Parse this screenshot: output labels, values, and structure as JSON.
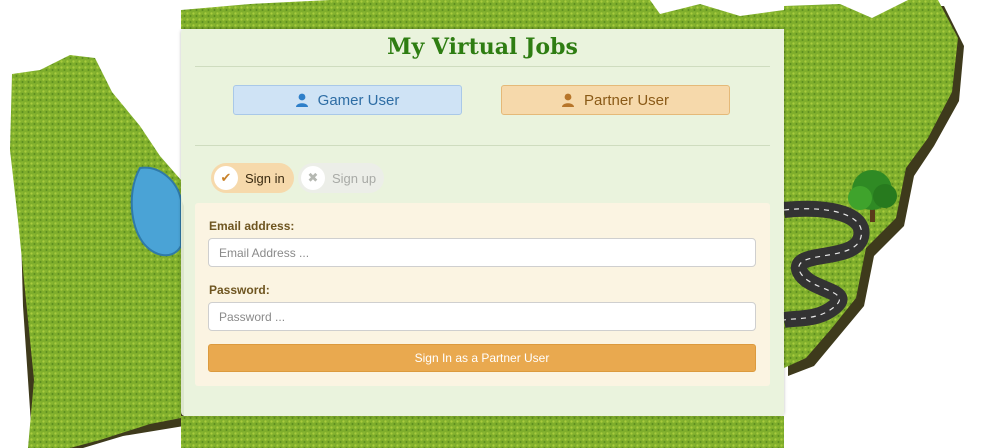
{
  "app": {
    "title": "My Virtual Jobs"
  },
  "roles": {
    "gamer_label": "Gamer User",
    "partner_label": "Partner User"
  },
  "auth_tabs": {
    "signin_label": "Sign in",
    "signup_label": "Sign up",
    "active": "signin"
  },
  "form": {
    "email_label": "Email address:",
    "email_placeholder": "Email Address ...",
    "email_value": "",
    "password_label": "Password:",
    "password_placeholder": "Password ...",
    "password_value": "",
    "submit_label": "Sign In as a Partner User"
  },
  "colors": {
    "title": "#2e7d12",
    "gamer": "#cfe3f5",
    "partner": "#f6d9ab",
    "submit": "#e9a94f"
  },
  "icons": {
    "gamer": "user-icon",
    "partner": "user-icon",
    "signin": "check-icon",
    "signup": "close-icon"
  }
}
